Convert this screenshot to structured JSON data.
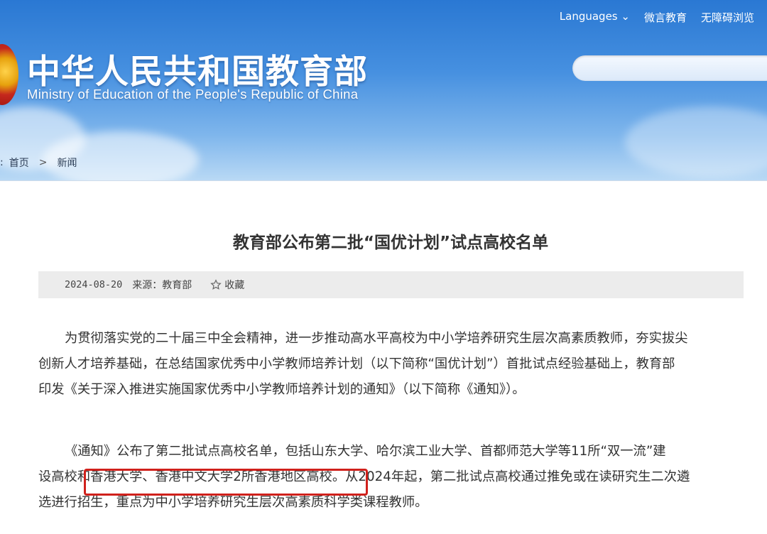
{
  "header": {
    "title_cn": "中华人民共和国教育部",
    "title_en": "Ministry of Education of the People's Republic of China",
    "nav": {
      "languages": "Languages",
      "weiyan": "微言教育",
      "accessibility": "无障碍浏览"
    },
    "search": {
      "placeholder": ""
    }
  },
  "breadcrumb": {
    "prefix": ":",
    "home": "首页",
    "separator": ">",
    "current": "新闻"
  },
  "article": {
    "title": "教育部公布第二批“国优计划”试点高校名单",
    "date": "2024-08-20",
    "source": "来源：教育部",
    "favorite": "收藏",
    "para1_lines": [
      "为贯彻落实党的二十届三中全会精神，进一步推动高水平高校为中小学培养研究生层次高素质教师，夯实拔尖",
      "创新人才培养基础，在总结国家优秀中小学教师培养计划（以下简称“国优计划”）首批试点经验基础上，教育部",
      "印发《关于深入推进实施国家优秀中小学教师培养计划的通知》（以下简称《通知》）。"
    ],
    "para2_lines": [
      "《通知》公布了第二批试点高校名单，包括山东大学、哈尔滨工业大学、首都师范大学等11所“双一流”建",
      "设高校和香港大学、香港中文大学2所香港地区高校。从2024年起，第二批试点高校通过推免或在读研究生二次遴",
      "选进行招生，重点为中小学培养研究生层次高素质科学类课程教师。"
    ]
  },
  "colors": {
    "header_blue": "#2a78d3",
    "highlight_red": "#d0211c",
    "meta_bg": "#ececec"
  }
}
